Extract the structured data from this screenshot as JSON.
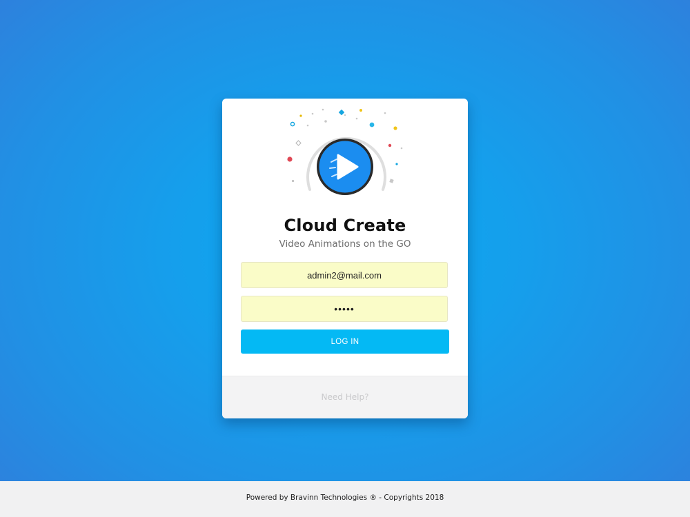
{
  "app": {
    "title": "Cloud Create",
    "subtitle": "Video Animations on the GO"
  },
  "login_form": {
    "email_value": "admin2@mail.com",
    "password_value": "•••••",
    "login_label": "LOG IN",
    "help_label": "Need Help?"
  },
  "footer": {
    "text": "Powered by Bravinn Technologies ® - Copyrights 2018"
  },
  "icons": {
    "logo": "play-button-icon"
  },
  "colors": {
    "background": "#159fec",
    "login_button": "#04b9f4",
    "input_fill": "#fafcc8",
    "logo_circle": "#1e8ef0"
  }
}
